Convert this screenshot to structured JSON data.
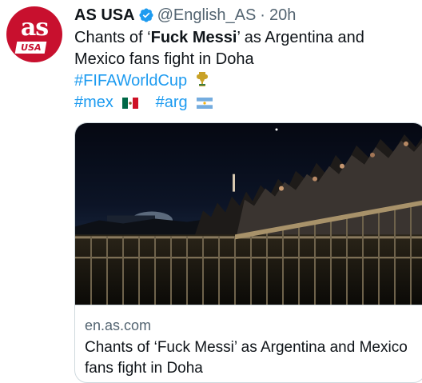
{
  "tweet": {
    "author_name": "AS USA",
    "handle": "@English_AS",
    "separator": "·",
    "time": "20h",
    "avatar": {
      "logo_text": "as",
      "logo_subtext": "USA",
      "icon": "as-usa-logo"
    },
    "verified_icon": "verified-badge-icon",
    "text": {
      "line1_pre": "Chants of ‘",
      "line1_bold": "Fuck Messi",
      "line1_post": "’ as Argentina and",
      "line2": "Mexico fans fight in Doha"
    },
    "hashtags": [
      {
        "tag": "#FIFAWorldCup",
        "emoji": "world-cup-trophy-icon"
      },
      {
        "tag": "#mex",
        "emoji": "mexico-flag-icon"
      },
      {
        "tag": "#arg",
        "emoji": "argentina-flag-icon"
      }
    ]
  },
  "link_card": {
    "domain": "en.as.com",
    "title": "Chants of ‘Fuck Messi’ as Argentina and Mexico fans fight in Doha",
    "image": "night-photo-fans-on-fence"
  },
  "colors": {
    "text": "#0f1419",
    "secondary": "#536471",
    "link": "#1d9bf0",
    "border": "#cfd9de",
    "brand_red": "#c8102e"
  }
}
